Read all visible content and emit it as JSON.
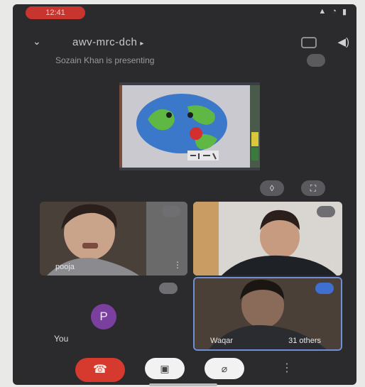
{
  "status": {
    "time": "12:41"
  },
  "meeting": {
    "code": "awv-mrc-dch",
    "presenting_text": "Sozain Khan is presenting"
  },
  "participants": [
    {
      "name": "pooja"
    },
    {
      "name": ""
    },
    {
      "name": "Waqar"
    }
  ],
  "others_label": "31 others",
  "self": {
    "label": "You",
    "avatar_letter": "P"
  },
  "colors": {
    "end_call": "#d63a2e",
    "avatar": "#7b3fa0",
    "highlight_border": "#6f8fd6"
  }
}
